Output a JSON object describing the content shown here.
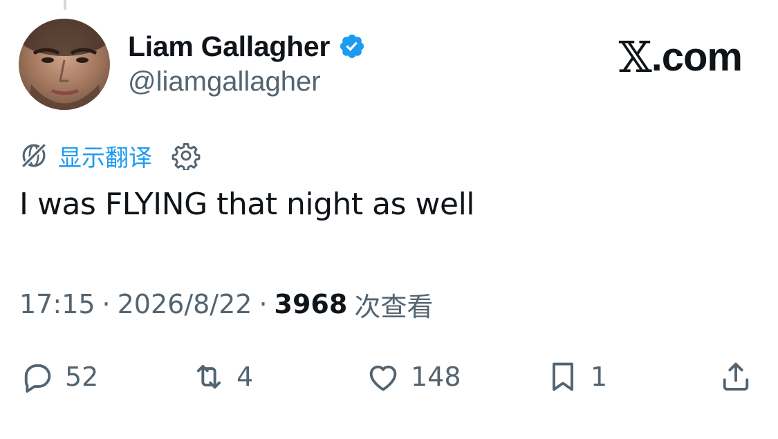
{
  "author": {
    "display_name": "Liam Gallagher",
    "handle": "@liamgallagher",
    "verified": true
  },
  "brand": {
    "x_glyph": "𝕏",
    "suffix": ".com"
  },
  "translate": {
    "link_label": "显示翻译"
  },
  "tweet": {
    "text": "I was FLYING that night as well"
  },
  "meta": {
    "time": "17:15",
    "separator": "·",
    "date": "2026/8/22",
    "views_count": "3968",
    "views_label": "次查看"
  },
  "actions": {
    "reply_count": "52",
    "retweet_count": "4",
    "like_count": "148",
    "bookmark_count": "1"
  },
  "colors": {
    "accent": "#1d9bf0",
    "muted": "#536471",
    "text": "#0f1419"
  }
}
